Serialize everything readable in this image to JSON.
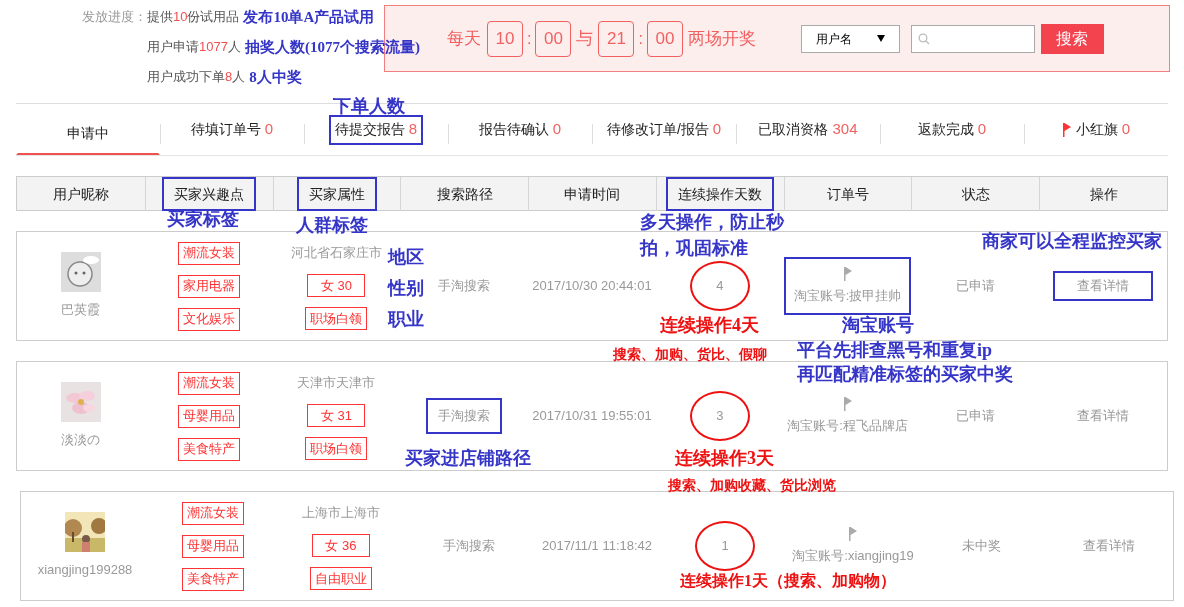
{
  "progress": {
    "label": "发放进度：",
    "lines": [
      {
        "before": "提供",
        "count": "10",
        "after": "份试用品",
        "note": "发布10单A产品试用"
      },
      {
        "before": "用户申请",
        "count": "1077",
        "after": "人",
        "note": "抽奖人数(1077个搜索流量)"
      },
      {
        "before": "用户成功下单",
        "count": "8",
        "after": "人",
        "note": "8人中奖"
      }
    ]
  },
  "lottery": {
    "prefix": "每天",
    "slots": [
      {
        "hour": "10",
        "minute": "00"
      },
      {
        "hour": "21",
        "minute": "00"
      }
    ],
    "colon": ":",
    "joiner": "与",
    "suffix": "两场开奖"
  },
  "search": {
    "select": "用户名",
    "button": "搜索"
  },
  "tabs": [
    {
      "label": "申请中",
      "selected": true,
      "boxed": false
    },
    {
      "label": "待填订单号",
      "count": "0",
      "selected": false,
      "boxed": false
    },
    {
      "label": "待提交报告",
      "count": "8",
      "selected": false,
      "boxed": true
    },
    {
      "label": "报告待确认",
      "count": "0",
      "selected": false,
      "boxed": false
    },
    {
      "label": "待修改订单/报告",
      "count": "0",
      "selected": false,
      "boxed": false
    },
    {
      "label": "已取消资格",
      "count": "304",
      "selected": false,
      "boxed": false
    },
    {
      "label": "返款完成",
      "count": "0",
      "selected": false,
      "boxed": false
    },
    {
      "label": "小红旗",
      "count": "0",
      "selected": false,
      "boxed": false,
      "kind": "flag"
    }
  ],
  "columns": [
    {
      "label": "用户昵称",
      "boxed": false
    },
    {
      "label": "买家兴趣点",
      "boxed": true
    },
    {
      "label": "买家属性",
      "boxed": true
    },
    {
      "label": "搜索路径",
      "boxed": false
    },
    {
      "label": "申请时间",
      "boxed": false
    },
    {
      "label": "连续操作天数",
      "boxed": true
    },
    {
      "label": "订单号",
      "boxed": false
    },
    {
      "label": "状态",
      "boxed": false
    },
    {
      "label": "操作",
      "boxed": false
    }
  ],
  "rows": [
    {
      "nickname": "巴英霞",
      "avatar": {
        "kind": "cartoon"
      },
      "interests": [
        "潮流女装",
        "家用电器",
        "文化娱乐"
      ],
      "region": "河北省石家庄市",
      "gender_age": "女 30",
      "job": "职场白领",
      "path": "手淘搜索",
      "path_boxed": false,
      "time": "2017/10/30 20:44:01",
      "days": "4",
      "days_circled": true,
      "account": "淘宝账号:披甲挂帅",
      "account_boxed": true,
      "status": "已申请",
      "action": "查看详情",
      "action_boxed": true
    },
    {
      "nickname": "淡淡の",
      "avatar": {
        "kind": "flower"
      },
      "interests": [
        "潮流女装",
        "母婴用品",
        "美食特产"
      ],
      "region": "天津市天津市",
      "gender_age": "女 31",
      "job": "职场白领",
      "path": "手淘搜索",
      "path_boxed": true,
      "time": "2017/10/31 19:55:01",
      "days": "3",
      "days_circled": true,
      "account": "淘宝账号:程飞品牌店",
      "account_boxed": false,
      "status": "已申请",
      "action": "查看详情",
      "action_boxed": false
    },
    {
      "nickname": "xiangjing199288",
      "avatar": {
        "kind": "park"
      },
      "interests": [
        "潮流女装",
        "母婴用品",
        "美食特产"
      ],
      "region": "上海市上海市",
      "gender_age": "女 36",
      "job": "自由职业",
      "path": "手淘搜索",
      "path_boxed": false,
      "time": "2017/11/1 11:18:42",
      "days": "1",
      "days_circled": true,
      "account": "淘宝账号:xiangjing19",
      "account_boxed": false,
      "status": "未中奖",
      "action": "查看详情",
      "action_boxed": false
    }
  ],
  "annotations": [
    {
      "text": "下单人数",
      "color": "#3535c8"
    },
    {
      "text": "买家标签",
      "color": "#3535c8"
    },
    {
      "text": "人群标签",
      "color": "#3535c8"
    },
    {
      "text": "多天操作，防止秒拍，巩固标准",
      "color": "#3535c8"
    },
    {
      "text": "商家可以全程监控买家",
      "color": "#3535c8"
    },
    {
      "text": "地区",
      "color": "#3535c8"
    },
    {
      "text": "性别",
      "color": "#3535c8"
    },
    {
      "text": "职业",
      "color": "#3535c8"
    },
    {
      "text": "连续操作4天",
      "color": "#ee1111"
    },
    {
      "text": "淘宝账号",
      "color": "#3535c8"
    },
    {
      "text": "搜索、加购、货比、假聊",
      "color": "#ee1111"
    },
    {
      "text": "平台先排查黑号和重复ip",
      "color": "#3535c8"
    },
    {
      "text": "再匹配精准标签的买家中奖",
      "color": "#3535c8"
    },
    {
      "text": "买家进店铺路径",
      "color": "#3535c8"
    },
    {
      "text": "连续操作3天",
      "color": "#ee1111"
    },
    {
      "text": "搜索、加购收藏、货比浏览",
      "color": "#ee1111"
    },
    {
      "text": "连续操作1天（搜索、加购物）",
      "color": "#ee1111"
    }
  ]
}
